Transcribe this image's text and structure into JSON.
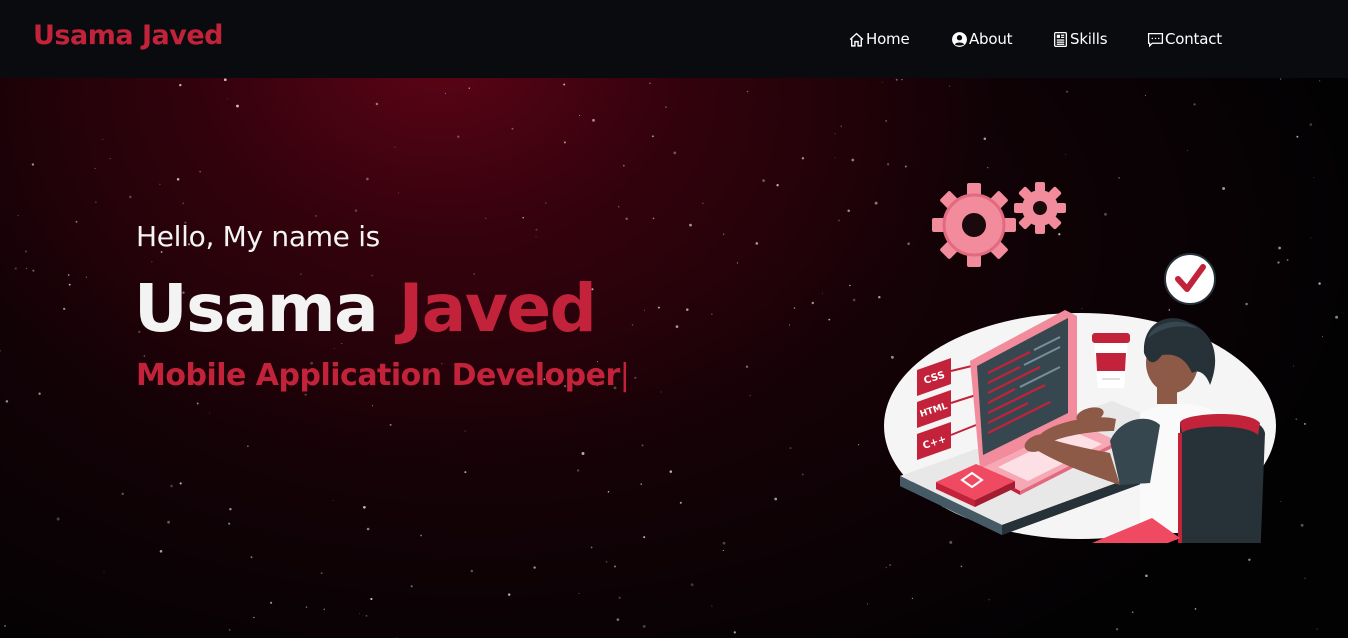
{
  "header": {
    "brand": "Usama Javed",
    "nav": [
      {
        "label": "Home",
        "icon": "home-icon"
      },
      {
        "label": "About",
        "icon": "user-circle-icon"
      },
      {
        "label": "Skills",
        "icon": "document-icon"
      },
      {
        "label": "Contact",
        "icon": "message-icon"
      }
    ]
  },
  "hero": {
    "greeting": "Hello, My name is",
    "first_name": "Usama",
    "last_name": "Javed",
    "role": "Mobile Application Developer",
    "cursor": "|",
    "illustration": {
      "subject": "developer-at-desk-illustration",
      "badges": [
        "CSS",
        "HTML",
        "C++"
      ]
    }
  },
  "colors": {
    "accent": "#c3233a",
    "nav_bg": "#0a0b0e",
    "hero_bg": "#020203",
    "glow": "#5f0416"
  }
}
